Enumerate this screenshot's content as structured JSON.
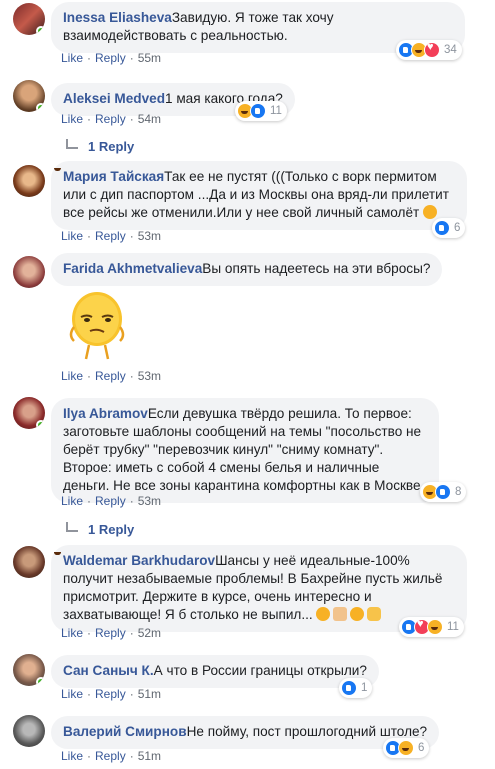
{
  "actions": {
    "like": "Like",
    "reply": "Reply",
    "sep": "·"
  },
  "comments": [
    {
      "author": "Inessa Eliasheva",
      "text": "Завидую. Я тоже так хочу взаимодействовать с реальностью.",
      "time": "55m",
      "reaction_count": "34",
      "reaction_icons": [
        "like-icon",
        "haha-icon",
        "love-icon"
      ],
      "online": true
    },
    {
      "author": "Aleksei Medved",
      "text": "1 мая какого года?",
      "time": "54m",
      "reaction_count": "11",
      "reaction_icons": [
        "haha-icon",
        "like-icon"
      ],
      "online": true,
      "replies_label": "1 Reply"
    },
    {
      "author": "Мария Тайская",
      "text": "Так ее не пустят (((Только с ворк пермитом или с дип паспортом ...Да и из Москвы она вряд-ли прилетит все рейсы же отменили.Или у нее свой личный самолёт",
      "time": "53m",
      "reaction_count": "6",
      "reaction_icons": [
        "like-icon"
      ],
      "online": false
    },
    {
      "author": "Farida Akhmetvalieva",
      "text": "Вы опять надеетесь на эти вбросы?",
      "time": "53m",
      "sticker": "meh-emoji-sticker",
      "online": false
    },
    {
      "author": "Ilya Abramov",
      "text": "Если девушка твёрдо решила. То первое: заготовьте шаблоны сообщений на темы \"посольство не берёт трубку\" \"перевозчик кинул\" \"сниму комнату\". Второе: иметь с собой 4 смены белья и наличные деньги. Не все зоны карантина комфортны как в Москве.",
      "time": "53m",
      "reaction_count": "8",
      "reaction_icons": [
        "haha-icon",
        "like-icon"
      ],
      "online": true,
      "replies_label": "1 Reply"
    },
    {
      "author": "Waldemar Barkhudarov",
      "text": "Шансы у неё идеальные-100% получит незабываемые проблемы! В Бахрейне пусть жильё присмотрит. Держите в курсе, очень интересно и захватывающе! Я б столько не выпил...",
      "time": "52m",
      "reaction_count": "11",
      "reaction_icons": [
        "like-icon",
        "love-icon",
        "haha-icon"
      ],
      "online": false
    },
    {
      "author": "Сан Саныч К.",
      "text": "А что в России границы открыли?",
      "time": "51m",
      "reaction_count": "1",
      "reaction_icons": [
        "like-icon"
      ],
      "online": true
    },
    {
      "author": "Валерий Смирнов",
      "text": "Не пойму, пост прошлогодний штоле?",
      "time": "51m",
      "reaction_count": "6",
      "reaction_icons": [
        "like-icon",
        "haha-icon"
      ],
      "online": false
    }
  ],
  "colors": {
    "author": "#385898",
    "bubble": "#f2f3f5",
    "online": "#42b72a",
    "like": "#1877f2",
    "haha": "#f7b125",
    "love": "#f33e58"
  }
}
